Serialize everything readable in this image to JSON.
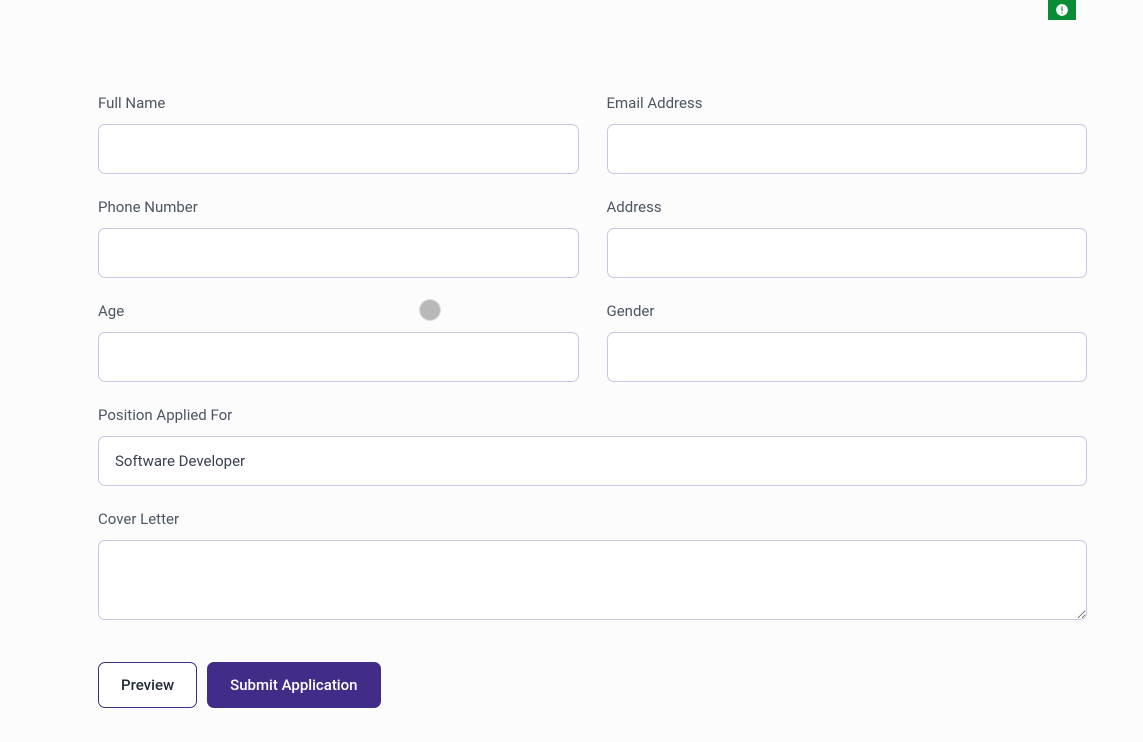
{
  "form": {
    "fullName": {
      "label": "Full Name",
      "value": ""
    },
    "emailAddress": {
      "label": "Email Address",
      "value": ""
    },
    "phoneNumber": {
      "label": "Phone Number",
      "value": ""
    },
    "address": {
      "label": "Address",
      "value": ""
    },
    "age": {
      "label": "Age",
      "value": ""
    },
    "gender": {
      "label": "Gender",
      "value": ""
    },
    "position": {
      "label": "Position Applied For",
      "value": "Software Developer"
    },
    "coverLetter": {
      "label": "Cover Letter",
      "value": ""
    }
  },
  "buttons": {
    "preview": "Preview",
    "submit": "Submit Application"
  }
}
